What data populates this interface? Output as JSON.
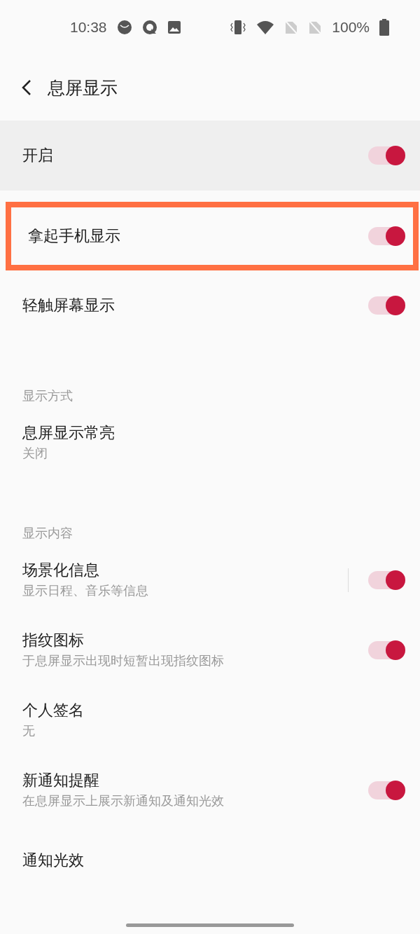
{
  "status_bar": {
    "time": "10:38",
    "battery": "100%"
  },
  "header": {
    "title": "息屏显示"
  },
  "main_switch": {
    "label": "开启",
    "on": true
  },
  "items": [
    {
      "kind": "toggle",
      "title": "拿起手机显示",
      "on": true,
      "highlighted": true,
      "divider": false
    },
    {
      "kind": "toggle",
      "title": "轻触屏幕显示",
      "on": true,
      "highlighted": false,
      "divider": false
    },
    {
      "kind": "section",
      "title": "显示方式"
    },
    {
      "kind": "text",
      "title": "息屏显示常亮",
      "subtitle": "关闭"
    },
    {
      "kind": "section",
      "title": "显示内容"
    },
    {
      "kind": "toggle",
      "title": "场景化信息",
      "subtitle": "显示日程、音乐等信息",
      "on": true,
      "highlighted": false,
      "divider": true
    },
    {
      "kind": "toggle",
      "title": "指纹图标",
      "subtitle": "于息屏显示出现时短暂出现指纹图标",
      "on": true,
      "highlighted": false,
      "divider": false
    },
    {
      "kind": "text",
      "title": "个人签名",
      "subtitle": "无"
    },
    {
      "kind": "toggle",
      "title": "新通知提醒",
      "subtitle": "在息屏显示上展示新通知及通知光效",
      "on": true,
      "highlighted": false,
      "divider": false
    },
    {
      "kind": "text",
      "title": "通知光效"
    }
  ]
}
